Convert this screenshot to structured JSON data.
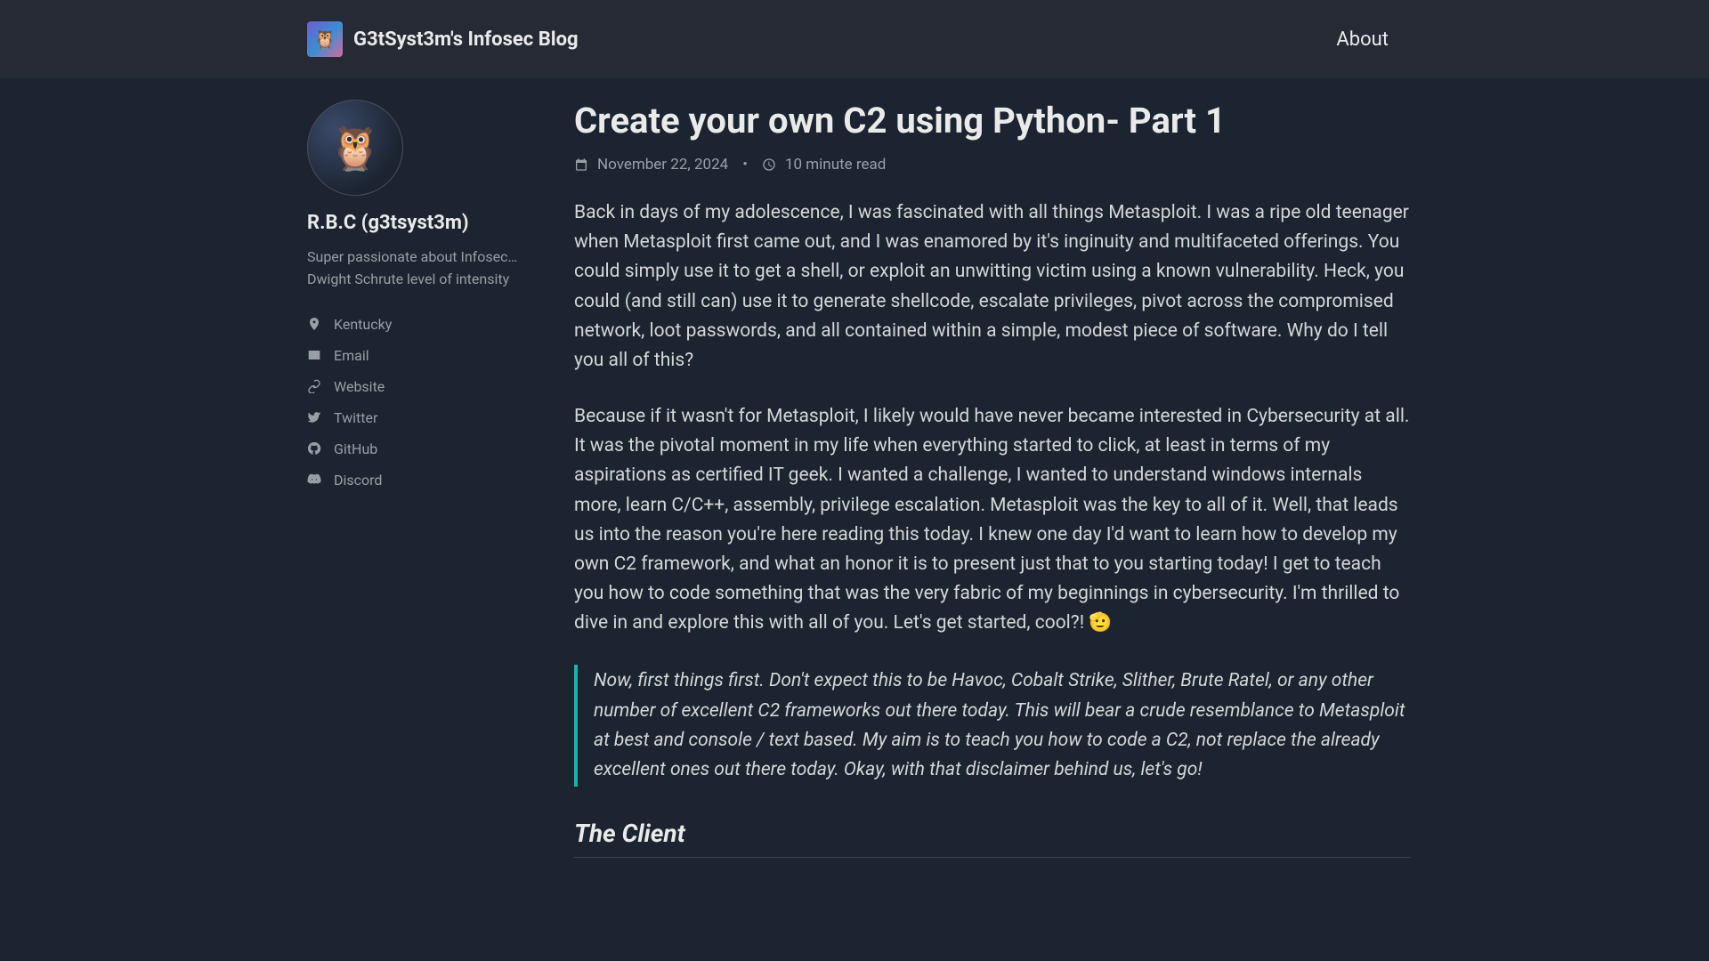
{
  "header": {
    "site_title": "G3tSyst3m's Infosec Blog",
    "nav_about": "About"
  },
  "sidebar": {
    "author_name": "R.B.C (g3tsyst3m)",
    "author_bio": "Super passionate about Infosec… Dwight Schrute level of intensity",
    "links": [
      {
        "icon": "pin-icon",
        "label": "Kentucky"
      },
      {
        "icon": "mail-icon",
        "label": "Email"
      },
      {
        "icon": "link-icon",
        "label": "Website"
      },
      {
        "icon": "twitter-icon",
        "label": "Twitter"
      },
      {
        "icon": "github-icon",
        "label": "GitHub"
      },
      {
        "icon": "discord-icon",
        "label": "Discord"
      }
    ]
  },
  "article": {
    "title": "Create your own C2 using Python- Part 1",
    "date": "November 22, 2024",
    "read_time": "10 minute read",
    "meta_separator": "•",
    "para1": "Back in days of my adolescence, I was fascinated with all things Metasploit. I was a ripe old teenager when Metasploit first came out, and I was enamored by it's inginuity and multifaceted offerings. You could simply use it to get a shell, or exploit an unwitting victim using a known vulnerability. Heck, you could (and still can) use it to generate shellcode, escalate privileges, pivot across the compromised network, loot passwords, and all contained within a simple, modest piece of software. Why do I tell you all of this?",
    "para2": "Because if it wasn't for Metasploit, I likely would have never became interested in Cybersecurity at all. It was the pivotal moment in my life when everything started to click, at least in terms of my aspirations as certified IT geek. I wanted a challenge, I wanted to understand windows internals more, learn C/C++, assembly, privilege escalation. Metasploit was the key to all of it. Well, that leads us into the reason you're here reading this today. I knew one day I'd want to learn how to develop my own C2 framework, and what an honor it is to present just that to you starting today! I get to teach you how to code something that was the very fabric of my beginnings in cybersecurity. I'm thrilled to dive in and explore this with all of you. Let's get started, cool?! 🫡",
    "quote": "Now, first things first. Don't expect this to be Havoc, Cobalt Strike, Slither, Brute Ratel, or any other number of excellent C2 frameworks out there today. This will bear a crude resemblance to Metasploit at best and console / text based. My aim is to teach you how to code a C2, not replace the already excellent ones out there today. Okay, with that disclaimer behind us, let's go!",
    "section1": "The Client"
  }
}
